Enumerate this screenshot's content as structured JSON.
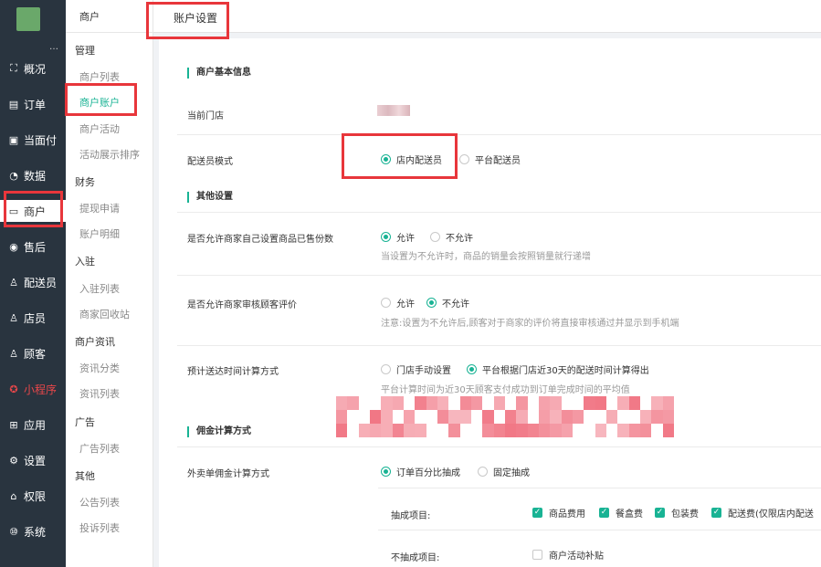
{
  "sidebar": {
    "items": [
      {
        "label": "概况",
        "icon": "overview-icon",
        "glyph": "⛶"
      },
      {
        "label": "订单",
        "icon": "order-icon",
        "glyph": "▤"
      },
      {
        "label": "当面付",
        "icon": "face-pay-icon",
        "glyph": "▣"
      },
      {
        "label": "数据",
        "icon": "data-icon",
        "glyph": "◔"
      },
      {
        "label": "商户",
        "icon": "merchant-icon",
        "glyph": "▭"
      },
      {
        "label": "售后",
        "icon": "after-sale-icon",
        "glyph": "◉"
      },
      {
        "label": "配送员",
        "icon": "courier-icon",
        "glyph": "♙"
      },
      {
        "label": "店员",
        "icon": "clerk-icon",
        "glyph": "♙"
      },
      {
        "label": "顾客",
        "icon": "customer-icon",
        "glyph": "♙"
      },
      {
        "label": "小程序",
        "icon": "mini-program-icon",
        "glyph": "✪"
      },
      {
        "label": "应用",
        "icon": "apps-icon",
        "glyph": "⊞"
      },
      {
        "label": "设置",
        "icon": "gear-icon",
        "glyph": "⚙"
      },
      {
        "label": "权限",
        "icon": "lock-icon",
        "glyph": "⌂"
      },
      {
        "label": "系统",
        "icon": "system-icon",
        "glyph": "⑩"
      }
    ]
  },
  "submenu": {
    "header": "商户",
    "groups": {
      "manage": "管理",
      "finance": "财务",
      "join": "入驻",
      "news": "商户资讯",
      "ads": "广告",
      "other": "其他"
    },
    "items": {
      "merchant_list": "商户列表",
      "merchant_account": "商户账户",
      "merchant_activity": "商户活动",
      "activity_sort": "活动展示排序",
      "withdraw_apply": "提现申请",
      "account_detail": "账户明细",
      "join_list": "入驻列表",
      "merchant_recycle": "商家回收站",
      "news_category": "资讯分类",
      "news_list": "资讯列表",
      "ad_list": "广告列表",
      "notice_list": "公告列表",
      "complaint_list": "投诉列表"
    }
  },
  "topbar": {
    "tab": "账户设置"
  },
  "form": {
    "basic": {
      "title": "商户基本信息",
      "current_store_label": "当前门店",
      "courier_mode_label": "配送员模式",
      "courier_mode_options": [
        "店内配送员",
        "平台配送员"
      ]
    },
    "other": {
      "title": "其他设置",
      "sold_count_label": "是否允许商家自己设置商品已售份数",
      "sold_count_options": [
        "允许",
        "不允许"
      ],
      "sold_count_hint": "当设置为不允许时，商品的销量会按照销量就行递增",
      "review_label": "是否允许商家审核顾客评价",
      "review_options": [
        "允许",
        "不允许"
      ],
      "review_hint": "注意:设置为不允许后,顾客对于商家的评价将直接审核通过并显示到手机端",
      "eta_label": "预计送达时间计算方式",
      "eta_options": [
        "门店手动设置",
        "平台根据门店近30天的配送时间计算得出"
      ],
      "eta_hint": "平台计算时间为近30天顾客支付成功到订单完成时间的平均值"
    },
    "commission": {
      "title": "佣金计算方式",
      "method_label": "外卖单佣金计算方式",
      "method_options": [
        "订单百分比抽成",
        "固定抽成"
      ],
      "include_label": "抽成项目:",
      "include_items": [
        "商品费用",
        "餐盒费",
        "包装费",
        "配送费(仅限店内配送"
      ],
      "exclude_label": "不抽成项目:",
      "exclude_items": [
        "商户活动补贴"
      ]
    }
  },
  "colors": {
    "accent": "#19b394",
    "sidebar_bg": "#29343f",
    "highlight_red": "#e8363b"
  }
}
